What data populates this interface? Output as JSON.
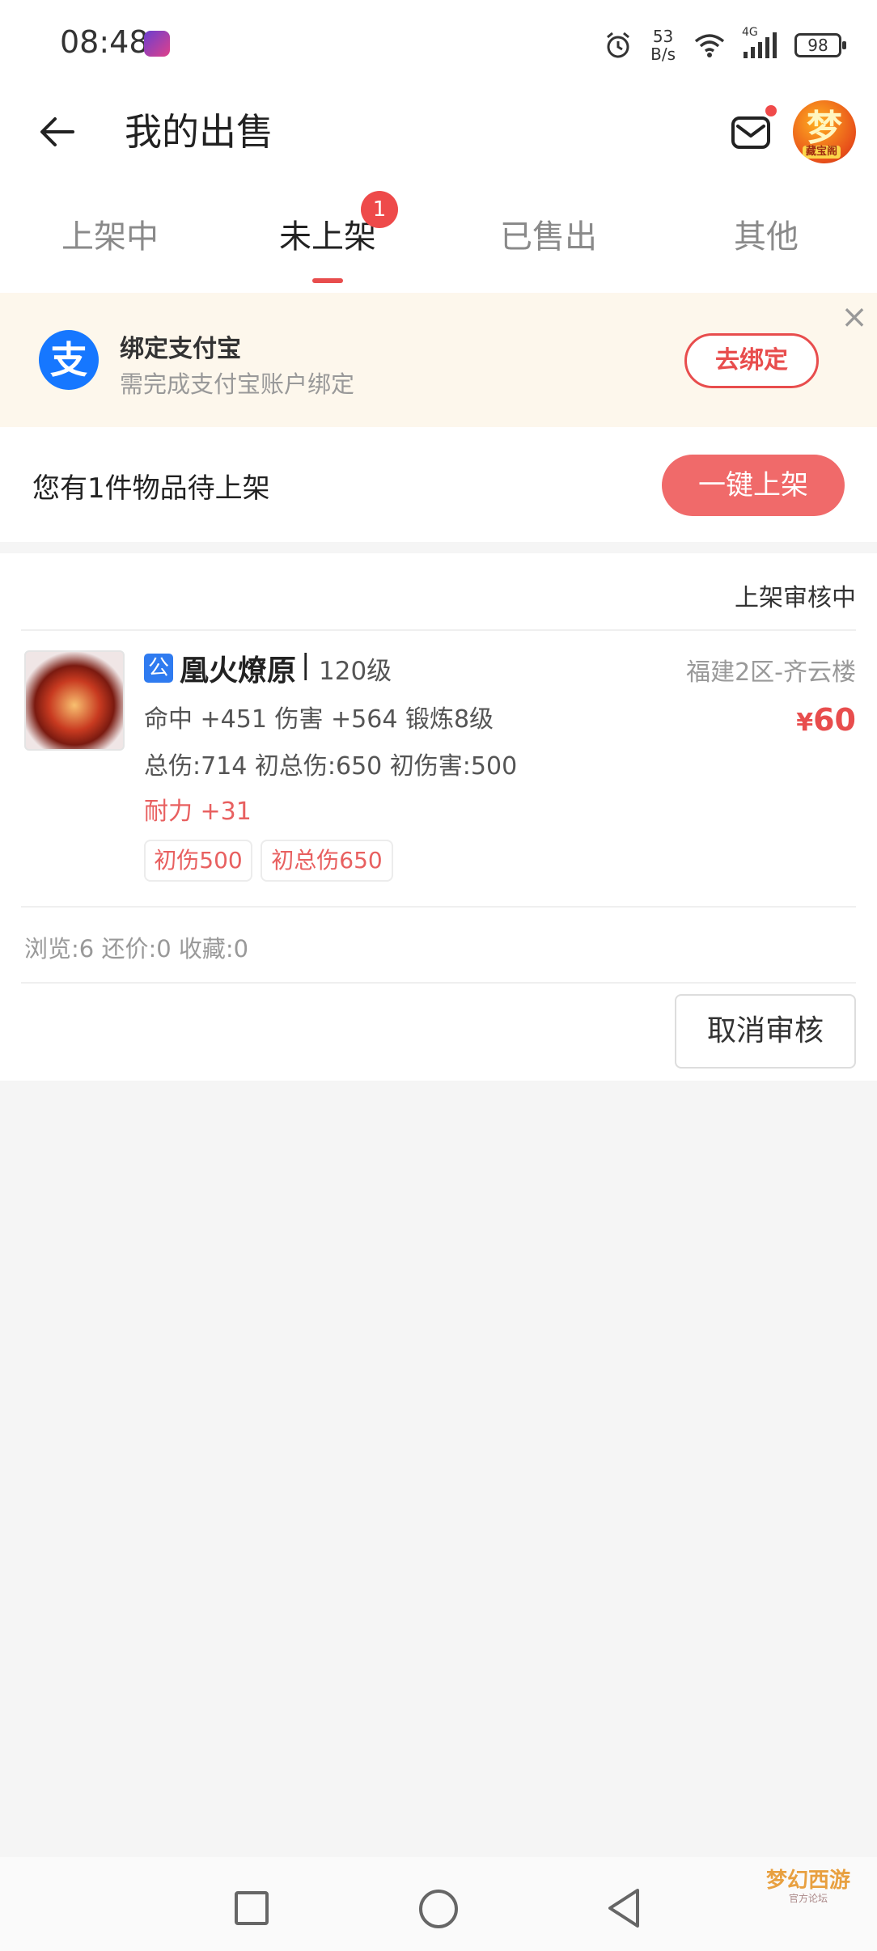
{
  "status_bar": {
    "time": "08:48",
    "net_speed_value": "53",
    "net_speed_unit": "B/s",
    "network_type": "4G",
    "battery": "98",
    "icons": [
      "app-notification-icon",
      "alarm-icon",
      "wifi-icon",
      "signal-icon",
      "battery-icon"
    ]
  },
  "header": {
    "title": "我的出售",
    "avatar_text": "梦",
    "avatar_caption": "藏宝阁"
  },
  "tabs": {
    "items": [
      {
        "label": "上架中"
      },
      {
        "label": "未上架"
      },
      {
        "label": "已售出"
      },
      {
        "label": "其他"
      }
    ],
    "active_index": 1,
    "badge": "1"
  },
  "banner": {
    "icon_text": "支",
    "title": "绑定支付宝",
    "subtitle": "需完成支付宝账户绑定",
    "button": "去绑定",
    "close": "×"
  },
  "pending": {
    "text": "您有1件物品待上架",
    "button": "一键上架"
  },
  "item": {
    "status": "上架审核中",
    "tag": "公",
    "name": "凰火燎原",
    "separator": "|",
    "level": "120级",
    "server": "福建2区-齐云楼",
    "price_symbol": "¥",
    "price": "60",
    "attrs": "命中 +451 伤害 +564 锻炼8级",
    "totals": "总伤:714 初总伤:650 初伤害:500",
    "extra": "耐力 +31",
    "tags": [
      "初伤500",
      "初总伤650"
    ],
    "stats": "浏览:6 还价:0 收藏:0",
    "cancel_button": "取消审核"
  },
  "watermark": {
    "title": "梦幻西游",
    "subtitle": "官方论坛"
  },
  "colors": {
    "accent": "#e84d4d",
    "alipay": "#1677ff",
    "banner_bg": "#fdf7ec",
    "page_bg": "#f5f5f5"
  }
}
